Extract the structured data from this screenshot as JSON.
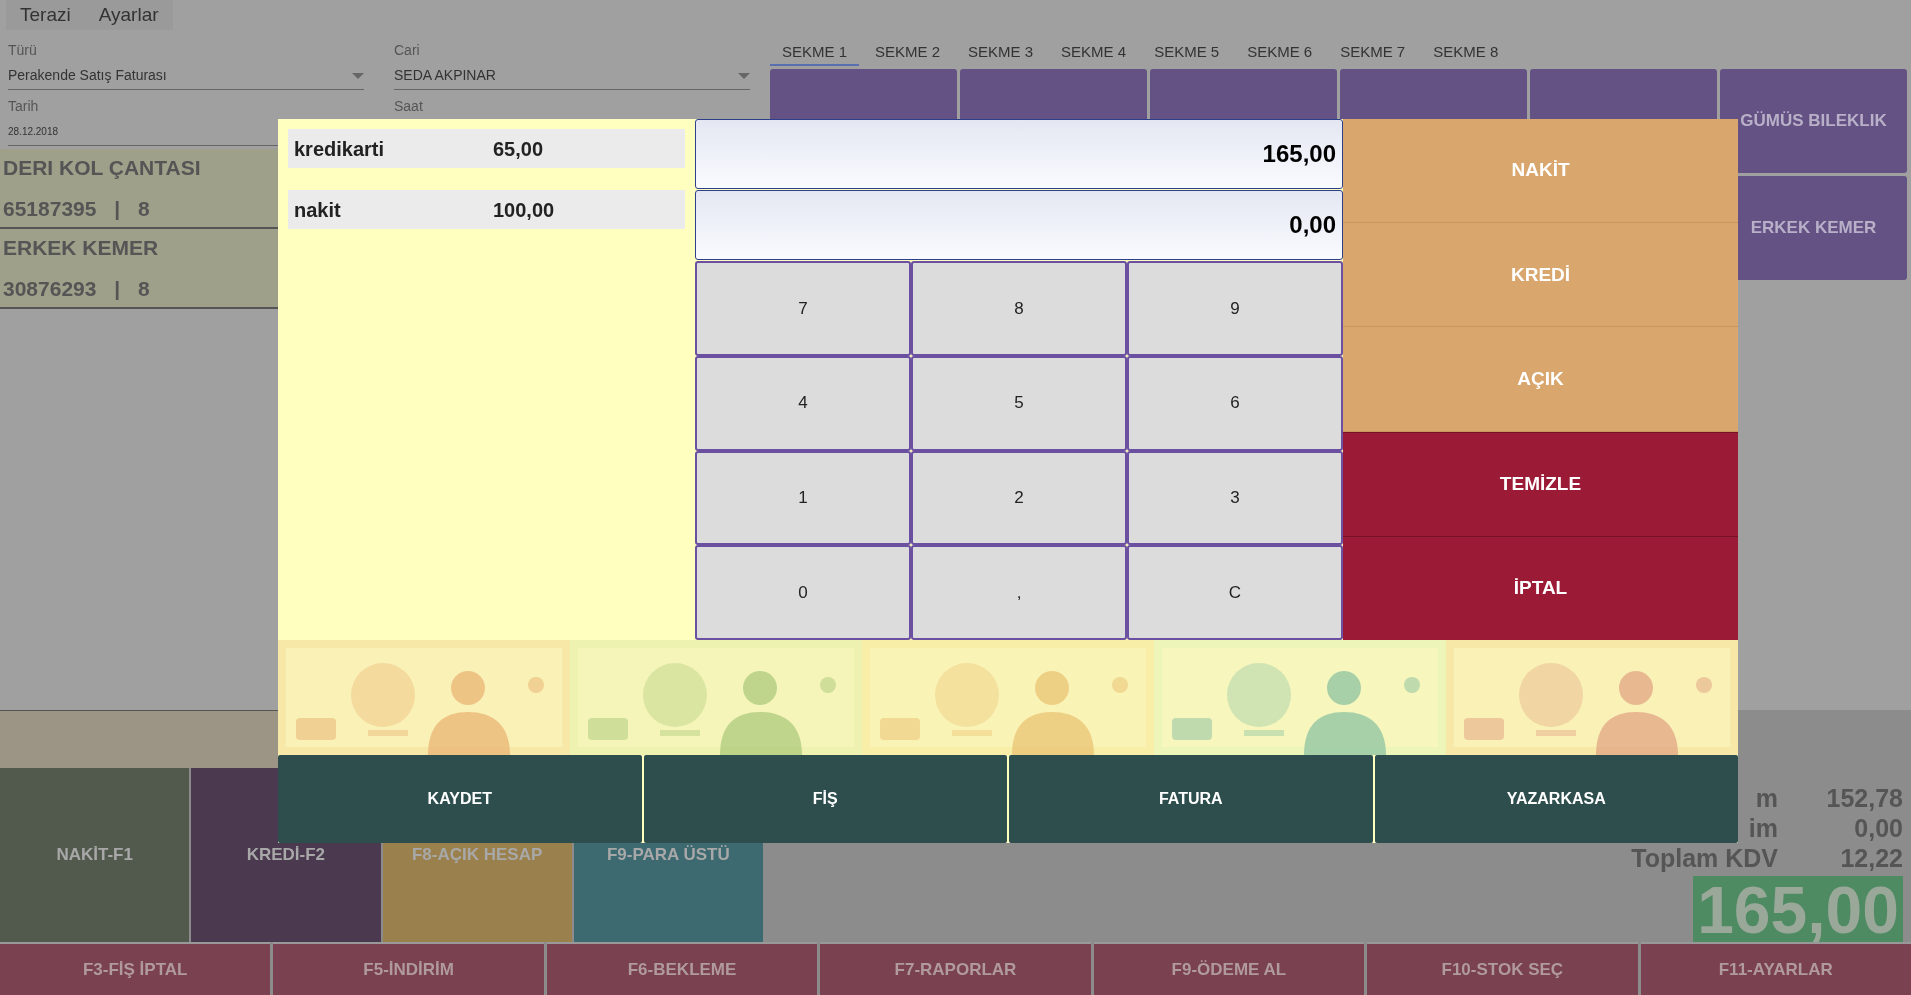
{
  "menu": [
    {
      "label": "Terazi"
    },
    {
      "label": "Ayarlar"
    }
  ],
  "form": {
    "type": {
      "label": "Türü",
      "value": "Perakende Satış Faturası"
    },
    "customer": {
      "label": "Cari",
      "value": "SEDA AKPINAR"
    },
    "date": {
      "label": "Tarih",
      "value": "28.12.2018"
    },
    "time": {
      "label": "Saat"
    }
  },
  "tabs": [
    {
      "label": "SEKME 1",
      "selected": true
    },
    {
      "label": "SEKME 2",
      "selected": false
    },
    {
      "label": "SEKME 3",
      "selected": false
    },
    {
      "label": "SEKME 4",
      "selected": false
    },
    {
      "label": "SEKME 5",
      "selected": false
    },
    {
      "label": "SEKME 6",
      "selected": false
    },
    {
      "label": "SEKME 7",
      "selected": false
    },
    {
      "label": "SEKME 8",
      "selected": false
    }
  ],
  "product_buttons": [
    {
      "label": "GÜMÜS BILEKLIK"
    },
    {
      "label": "ERKEK KEMER"
    }
  ],
  "cart_items": [
    {
      "name": "DERI KOL ÇANTASI",
      "detail": "65187395 | 8"
    },
    {
      "name": "ERKEK KEMER",
      "detail": "30876293 | 8"
    }
  ],
  "payment_tiles": [
    {
      "label": "NAKİT-F1",
      "color": "#525a4e"
    },
    {
      "label": "KREDİ-F2",
      "color": "#4b394f"
    },
    {
      "label": "F8-AÇIK HESAP",
      "color": "#9a804c"
    },
    {
      "label": "F9-PARA ÜSTÜ",
      "color": "#3d6a70"
    }
  ],
  "totals": [
    {
      "label": "m",
      "value": "152,78"
    },
    {
      "label": "im",
      "value": "0,00"
    },
    {
      "label": "Toplam KDV",
      "value": "12,22"
    }
  ],
  "grand_total": "165,00",
  "function_keys": [
    "F3-FİŞ İPTAL",
    "F5-İNDİRİM",
    "F6-BEKLEME",
    "F7-RAPORLAR",
    "F9-ÖDEME AL",
    "F10-STOK SEÇ",
    "F11-AYARLAR"
  ],
  "dialog": {
    "payments": [
      {
        "method": "kredikarti",
        "amount": "65,00"
      },
      {
        "method": "nakit",
        "amount": "100,00"
      }
    ],
    "displays": [
      "165,00",
      "0,00"
    ],
    "keys": [
      "7",
      "8",
      "9",
      "4",
      "5",
      "6",
      "1",
      "2",
      "3",
      "0",
      ",",
      "C"
    ],
    "actions": [
      {
        "label": "NAKİT",
        "kind": "payment"
      },
      {
        "label": "KREDİ",
        "kind": "payment"
      },
      {
        "label": "AÇIK",
        "kind": "payment"
      },
      {
        "label": "TEMİZLE",
        "kind": "danger"
      },
      {
        "label": "İPTAL",
        "kind": "danger"
      }
    ],
    "banknotes": [
      {
        "kind": "picture"
      },
      {
        "kind": "picture"
      },
      {
        "kind": "picture"
      },
      {
        "kind": "picture"
      },
      {
        "kind": "picture"
      }
    ],
    "buttons": [
      "KAYDET",
      "FİŞ",
      "FATURA",
      "YAZARKASA"
    ]
  }
}
